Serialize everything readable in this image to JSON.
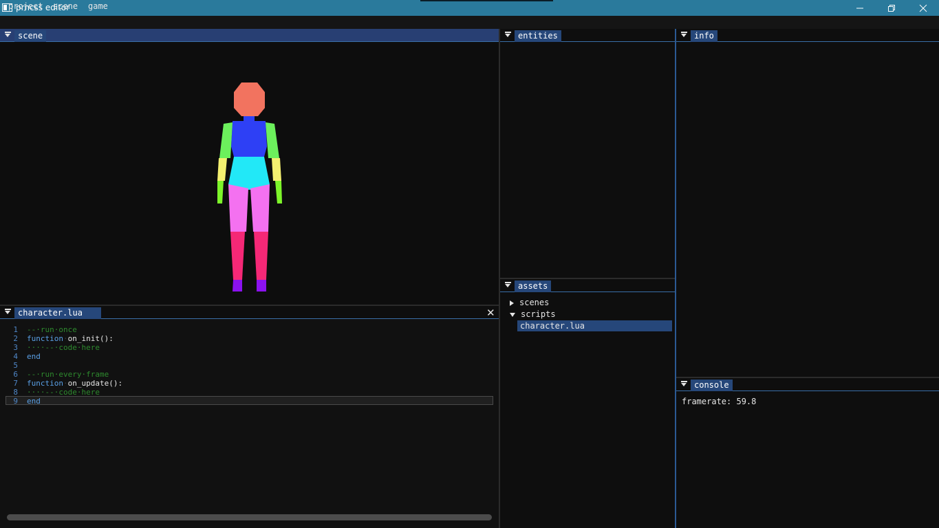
{
  "window": {
    "title": "prncss editor"
  },
  "menu": {
    "items": [
      "project",
      "scene",
      "game"
    ]
  },
  "panels": {
    "scene": {
      "tab": "scene"
    },
    "entities": {
      "tab": "entities"
    },
    "info": {
      "tab": "info"
    },
    "assets": {
      "tab": "assets",
      "tree": [
        {
          "label": "scenes",
          "expanded": false
        },
        {
          "label": "scripts",
          "expanded": true
        },
        {
          "label": "character.lua",
          "selected": true
        }
      ]
    },
    "console": {
      "tab": "console",
      "lines": [
        "framerate: 59.8"
      ]
    },
    "editor": {
      "tab": "character.lua"
    }
  },
  "code": {
    "lines": [
      {
        "n": "1",
        "text": "--·run·once"
      },
      {
        "n": "2",
        "kw": "function",
        "text": "on_init():"
      },
      {
        "n": "3",
        "text": "····--·code·here"
      },
      {
        "n": "4",
        "kw": "end"
      },
      {
        "n": "5"
      },
      {
        "n": "6",
        "text": "--·run·every·frame"
      },
      {
        "n": "7",
        "kw": "function",
        "text": "on_update():"
      },
      {
        "n": "8",
        "text": "····--·code·here"
      },
      {
        "n": "9",
        "kw": "end"
      }
    ],
    "current_line": "9"
  },
  "scene_model": {
    "colors": {
      "head": "#f2735f",
      "torso": "#2e40f5",
      "hips": "#22e8f7",
      "upper_arm": "#6cf05c",
      "forearm": "#f4f070",
      "hand": "#7df52a",
      "thigh": "#f471f0",
      "shin": "#f52876",
      "foot": "#8b12f0"
    }
  }
}
